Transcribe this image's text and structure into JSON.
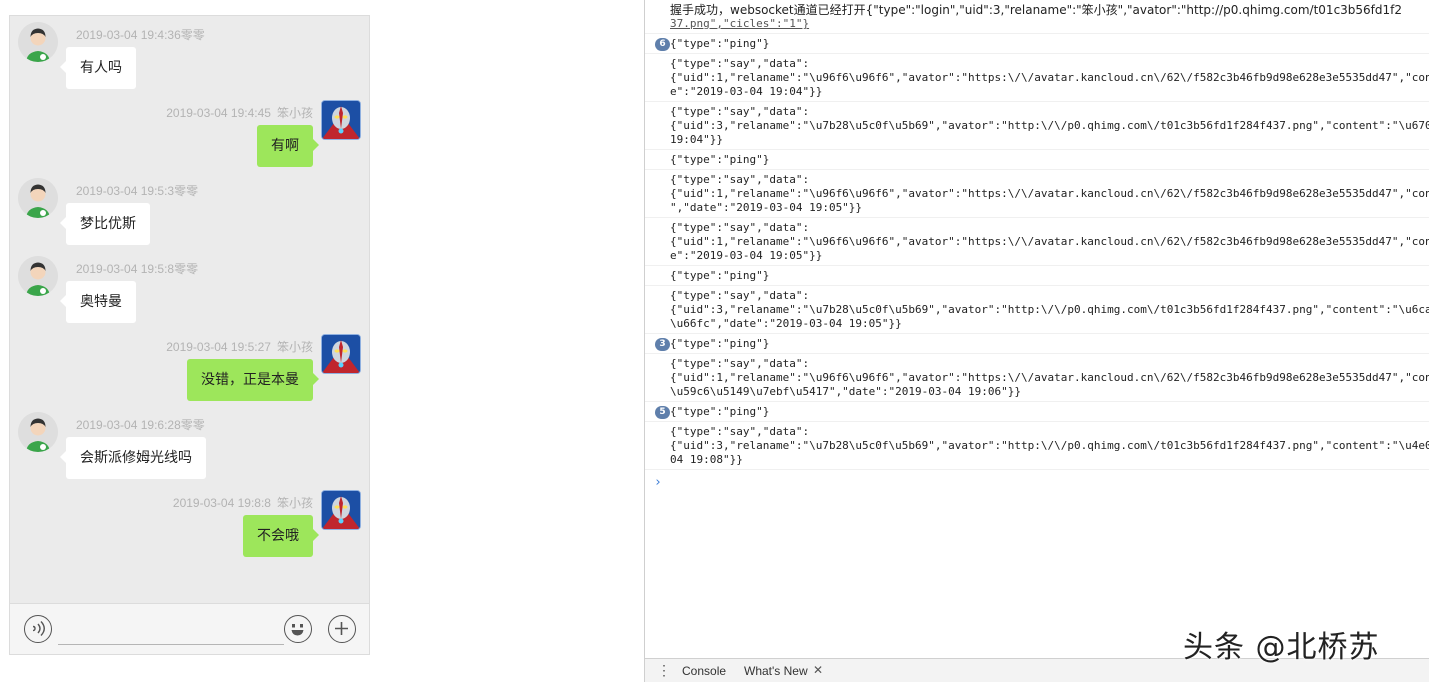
{
  "chat": {
    "messages": [
      {
        "side": "left",
        "time": "2019-03-04 19:4:36",
        "name": "零零",
        "text": "有人吗",
        "avatar": "user-avatar"
      },
      {
        "side": "right",
        "time": "2019-03-04 19:4:45",
        "name": "笨小孩",
        "text": "有啊",
        "avatar": "ultraman-avatar"
      },
      {
        "side": "left",
        "time": "2019-03-04 19:5:3",
        "name": "零零",
        "text": "梦比优斯",
        "avatar": "user-avatar"
      },
      {
        "side": "left",
        "time": "2019-03-04 19:5:8",
        "name": "零零",
        "text": "奥特曼",
        "avatar": "user-avatar"
      },
      {
        "side": "right",
        "time": "2019-03-04 19:5:27",
        "name": "笨小孩",
        "text": "没错，正是本曼",
        "avatar": "ultraman-avatar"
      },
      {
        "side": "left",
        "time": "2019-03-04 19:6:28",
        "name": "零零",
        "text": "会斯派修姆光线吗",
        "avatar": "user-avatar"
      },
      {
        "side": "right",
        "time": "2019-03-04 19:8:8",
        "name": "笨小孩",
        "text": "不会哦",
        "avatar": "ultraman-avatar"
      }
    ],
    "toolbar": {
      "voice_icon": "voice-icon",
      "emoji_icon": "emoji-icon",
      "plus_icon": "plus-icon",
      "input_value": ""
    },
    "colors": {
      "own_bubble": "#9de65b",
      "other_bubble": "#ffffff",
      "background": "#ebebeb"
    }
  },
  "console": {
    "logs": [
      {
        "badge": "",
        "lines": [
          "握手成功，websocket通道已经打开{\"type\":\"login\",\"uid\":3,\"relaname\":\"笨小孩\",\"avator\":\"http://p0.qhimg.com/t01c3b56fd1f2",
          "37.png\",\"cicles\":\"1\"}"
        ]
      },
      {
        "badge": "6",
        "lines": [
          "{\"type\":\"ping\"}"
        ]
      },
      {
        "badge": "",
        "lines": [
          "{\"type\":\"say\",\"data\":",
          "{\"uid\":1,\"relaname\":\"\\u96f6\\u96f6\",\"avator\":\"https:\\/\\/avatar.kancloud.cn\\/62\\/f582c3b46fb9d98e628e3e5535dd47\",\"con",
          "e\":\"2019-03-04 19:04\"}}"
        ]
      },
      {
        "badge": "",
        "lines": [
          "{\"type\":\"say\",\"data\":",
          "{\"uid\":3,\"relaname\":\"\\u7b28\\u5c0f\\u5b69\",\"avator\":\"http:\\/\\/p0.qhimg.com\\/t01c3b56fd1f284f437.png\",\"content\":\"\\u670",
          "19:04\"}}"
        ]
      },
      {
        "badge": "",
        "lines": [
          "{\"type\":\"ping\"}"
        ]
      },
      {
        "badge": "",
        "lines": [
          "{\"type\":\"say\",\"data\":",
          "{\"uid\":1,\"relaname\":\"\\u96f6\\u96f6\",\"avator\":\"https:\\/\\/avatar.kancloud.cn\\/62\\/f582c3b46fb9d98e628e3e5535dd47\",\"con",
          "\",\"date\":\"2019-03-04 19:05\"}}"
        ]
      },
      {
        "badge": "",
        "lines": [
          "{\"type\":\"say\",\"data\":",
          "{\"uid\":1,\"relaname\":\"\\u96f6\\u96f6\",\"avator\":\"https:\\/\\/avatar.kancloud.cn\\/62\\/f582c3b46fb9d98e628e3e5535dd47\",\"con",
          "e\":\"2019-03-04 19:05\"}}"
        ]
      },
      {
        "badge": "",
        "lines": [
          "{\"type\":\"ping\"}"
        ]
      },
      {
        "badge": "",
        "lines": [
          "{\"type\":\"say\",\"data\":",
          "{\"uid\":3,\"relaname\":\"\\u7b28\\u5c0f\\u5b69\",\"avator\":\"http:\\/\\/p0.qhimg.com\\/t01c3b56fd1f284f437.png\",\"content\":\"\\u6ca",
          "\\u66fc\",\"date\":\"2019-03-04 19:05\"}}"
        ]
      },
      {
        "badge": "3",
        "lines": [
          "{\"type\":\"ping\"}"
        ]
      },
      {
        "badge": "",
        "lines": [
          "{\"type\":\"say\",\"data\":",
          "{\"uid\":1,\"relaname\":\"\\u96f6\\u96f6\",\"avator\":\"https:\\/\\/avatar.kancloud.cn\\/62\\/f582c3b46fb9d98e628e3e5535dd47\",\"con",
          "\\u59c6\\u5149\\u7ebf\\u5417\",\"date\":\"2019-03-04 19:06\"}}"
        ]
      },
      {
        "badge": "5",
        "lines": [
          "{\"type\":\"ping\"}"
        ]
      },
      {
        "badge": "",
        "lines": [
          "{\"type\":\"say\",\"data\":",
          "{\"uid\":3,\"relaname\":\"\\u7b28\\u5c0f\\u5b69\",\"avator\":\"http:\\/\\/p0.qhimg.com\\/t01c3b56fd1f284f437.png\",\"content\":\"\\u4e0",
          "04 19:08\"}}"
        ]
      }
    ],
    "prompt": "›",
    "drawer": {
      "menu": "⋮",
      "tab_console": "Console",
      "tab_whatsnew": "What's New",
      "close": "✕"
    }
  },
  "watermark": "头条 @北桥苏"
}
